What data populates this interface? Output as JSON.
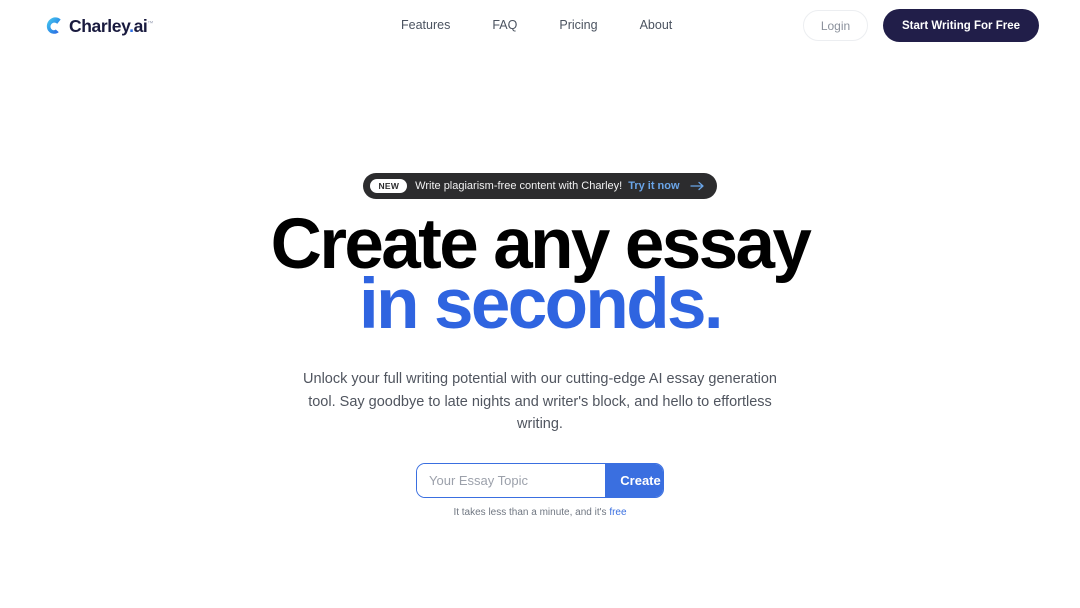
{
  "brand": {
    "name": "Charley",
    "dot": ".",
    "suffix": "ai",
    "tm": "™",
    "mark_icon": "charley-logo-icon"
  },
  "nav": {
    "items": [
      {
        "label": "Features"
      },
      {
        "label": "FAQ"
      },
      {
        "label": "Pricing"
      },
      {
        "label": "About"
      }
    ]
  },
  "header_actions": {
    "login_label": "Login",
    "cta_label": "Start Writing For Free"
  },
  "banner": {
    "badge": "NEW",
    "text": "Write plagiarism-free content with Charley!",
    "link_label": "Try it now",
    "arrow_icon": "arrow-right-icon"
  },
  "hero": {
    "headline_line1": "Create any essay",
    "headline_line2": "in seconds.",
    "subtitle": "Unlock your full writing potential with our cutting-edge AI essay generation tool. Say goodbye to late nights and writer's block, and hello to effortless writing.",
    "input_placeholder": "Your Essay Topic",
    "input_value": "",
    "create_label": "Create",
    "note_prefix": "It takes less than a minute, and it's ",
    "note_free": "free"
  },
  "colors": {
    "accent_blue": "#3a6fe0",
    "headline_blue": "#2f64e0",
    "cta_navy": "#211e49",
    "banner_dark": "#2c2c2e",
    "banner_link_blue": "#6aa5e8",
    "background": "#ffffff",
    "body_text": "#50555f"
  }
}
